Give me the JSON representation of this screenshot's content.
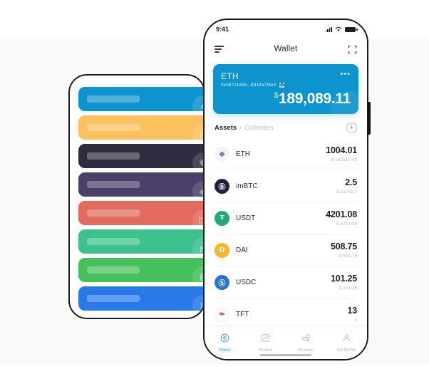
{
  "background": {
    "top_band": "#ffffff",
    "canvas": "#f9f9fa"
  },
  "left_phone": {
    "name": "token-card-stack",
    "cards": [
      {
        "label": "card-eth",
        "color": "#0d94ce",
        "icon": "♦",
        "icon_name": "ethereum-icon"
      },
      {
        "label": "card-btc",
        "color": "#fbc15e",
        "icon": "B",
        "icon_name": "bitcoin-icon"
      },
      {
        "label": "card-dark",
        "color": "#2e2e40",
        "icon": "✹",
        "icon_name": "cosmos-icon"
      },
      {
        "label": "card-eos",
        "color": "#4b4168",
        "icon": "◈",
        "icon_name": "eos-icon"
      },
      {
        "label": "card-trx",
        "color": "#e26a5f",
        "icon": "▷",
        "icon_name": "tron-icon"
      },
      {
        "label": "card-neo",
        "color": "#3cc18f",
        "icon": "N",
        "icon_name": "neo-icon"
      },
      {
        "label": "card-bch",
        "color": "#46c05c",
        "icon": "B",
        "icon_name": "bch-icon"
      },
      {
        "label": "card-ltc",
        "color": "#2979e8",
        "icon": "L",
        "icon_name": "litecoin-icon"
      }
    ]
  },
  "phone": {
    "status": {
      "time": "9:41",
      "signal_icon": "signal-bars-icon",
      "wifi_icon": "wifi-icon",
      "battery_icon": "battery-icon"
    },
    "nav": {
      "menu_icon": "hamburger-menu-icon",
      "title": "Wallet",
      "scan_icon": "scan-qr-icon"
    },
    "balance_card": {
      "symbol": "ETH",
      "address": "0x08711d3b...8418a7f8e3",
      "qr_icon": "qr-code-icon",
      "more_icon": "more-options-icon",
      "currency": "$",
      "amount": "189,089.11",
      "accent": "#0d94ce"
    },
    "tabs": {
      "assets_label": "Assets",
      "separator": "/",
      "collectibles_label": "Collectles",
      "add_label": "+"
    },
    "assets": [
      {
        "symbol": "ETH",
        "amount": "1004.01",
        "value": "$ 162517.48",
        "icon_bg": "#f4f4fa",
        "icon_fg": "#7a7fc4",
        "icon_glyph": "◆",
        "icon_name": "eth-token-icon"
      },
      {
        "symbol": "imBTC",
        "amount": "2.5",
        "value": "$ 21760.1",
        "icon_bg": "#1d1f3d",
        "icon_fg": "#ffffff",
        "icon_glyph": "Ⓑ",
        "icon_name": "imbtc-token-icon"
      },
      {
        "symbol": "USDT",
        "amount": "4201.08",
        "value": "$ 4201.08",
        "icon_bg": "#23a87a",
        "icon_fg": "#ffffff",
        "icon_glyph": "Ŧ",
        "icon_name": "usdt-token-icon"
      },
      {
        "symbol": "DAI",
        "amount": "508.75",
        "value": "$ 508.75",
        "icon_bg": "#f4b728",
        "icon_fg": "#ffffff",
        "icon_glyph": "Ð",
        "icon_name": "dai-token-icon"
      },
      {
        "symbol": "USDC",
        "amount": "101.25",
        "value": "$ 101.25",
        "icon_bg": "#2775ca",
        "icon_fg": "#ffffff",
        "icon_glyph": "Ⓢ",
        "icon_name": "usdc-token-icon"
      },
      {
        "symbol": "TFT",
        "amount": "13",
        "value": "0",
        "icon_bg": "#ffffff",
        "icon_fg": "#e8455f",
        "icon_glyph": "❧",
        "icon_name": "tft-token-icon"
      }
    ],
    "tabbar": {
      "active_color": "#3ea2e8",
      "items": [
        {
          "label": "Wallet",
          "icon_name": "wallet-tab-icon",
          "active": true
        },
        {
          "label": "Market",
          "icon_name": "market-tab-icon",
          "active": false
        },
        {
          "label": "Browser",
          "icon_name": "browser-tab-icon",
          "active": false
        },
        {
          "label": "My Profile",
          "icon_name": "profile-tab-icon",
          "active": false
        }
      ]
    }
  }
}
